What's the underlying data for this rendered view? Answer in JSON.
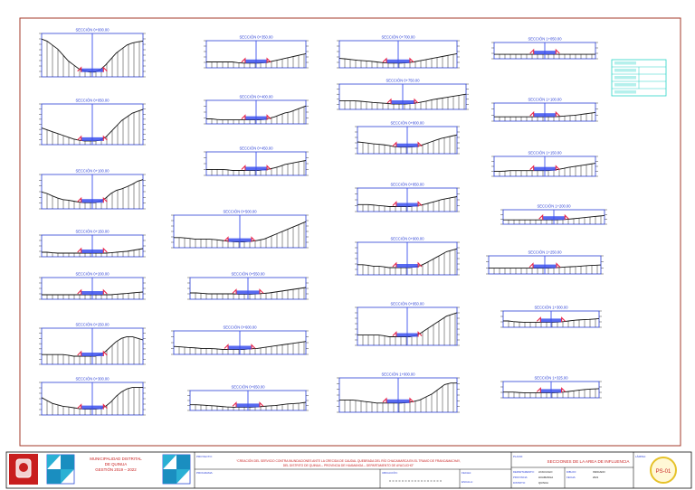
{
  "sheet": {
    "sections": [
      {
        "title": "SECCIÓN 0+000.00",
        "profile": [
          0.95,
          0.9,
          0.8,
          0.7,
          0.55,
          0.4,
          0.3,
          0.2,
          0.15,
          0.12,
          0.12,
          0.18,
          0.3,
          0.45,
          0.6,
          0.7,
          0.8,
          0.85,
          0.88,
          0.9
        ]
      },
      {
        "title": "SECCIÓN 0+050.00",
        "profile": [
          0.45,
          0.4,
          0.35,
          0.3,
          0.25,
          0.2,
          0.15,
          0.12,
          0.1,
          0.1,
          0.1,
          0.12,
          0.2,
          0.35,
          0.5,
          0.65,
          0.75,
          0.85,
          0.9,
          0.95
        ]
      },
      {
        "title": "SECCIÓN 0+100.00",
        "profile": [
          0.55,
          0.5,
          0.42,
          0.35,
          0.3,
          0.28,
          0.25,
          0.22,
          0.2,
          0.2,
          0.2,
          0.25,
          0.35,
          0.5,
          0.6,
          0.65,
          0.72,
          0.8,
          0.9,
          0.95
        ]
      },
      {
        "title": "SECCIÓN 0+150.00",
        "profile": [
          0.25,
          0.25,
          0.22,
          0.2,
          0.2,
          0.2,
          0.2,
          0.2,
          0.2,
          0.2,
          0.2,
          0.2,
          0.2,
          0.22,
          0.25,
          0.28,
          0.3,
          0.35,
          0.4,
          0.45
        ]
      },
      {
        "title": "SECCIÓN 0+200.00",
        "profile": [
          0.25,
          0.25,
          0.25,
          0.25,
          0.25,
          0.25,
          0.25,
          0.25,
          0.25,
          0.25,
          0.25,
          0.25,
          0.25,
          0.25,
          0.28,
          0.3,
          0.32,
          0.35,
          0.38,
          0.4
        ]
      },
      {
        "title": "SECCIÓN 0+250.00",
        "profile": [
          0.3,
          0.3,
          0.3,
          0.3,
          0.3,
          0.28,
          0.25,
          0.25,
          0.25,
          0.25,
          0.25,
          0.3,
          0.4,
          0.55,
          0.7,
          0.8,
          0.85,
          0.85,
          0.8,
          0.75
        ]
      },
      {
        "title": "SECCIÓN 0+300.00",
        "profile": [
          0.6,
          0.5,
          0.4,
          0.35,
          0.3,
          0.28,
          0.25,
          0.22,
          0.2,
          0.2,
          0.2,
          0.22,
          0.3,
          0.45,
          0.65,
          0.8,
          0.9,
          0.95,
          0.95,
          0.95
        ]
      },
      {
        "title": "SECCIÓN 0+350.00",
        "profile": [
          0.25,
          0.25,
          0.25,
          0.25,
          0.25,
          0.25,
          0.22,
          0.2,
          0.2,
          0.2,
          0.2,
          0.22,
          0.25,
          0.3,
          0.35,
          0.4,
          0.45,
          0.5,
          0.55,
          0.6
        ]
      },
      {
        "title": "SECCIÓN 0+400.00",
        "profile": [
          0.25,
          0.25,
          0.22,
          0.2,
          0.2,
          0.2,
          0.2,
          0.2,
          0.2,
          0.2,
          0.2,
          0.22,
          0.28,
          0.35,
          0.45,
          0.55,
          0.6,
          0.7,
          0.8,
          0.9
        ]
      },
      {
        "title": "SECCIÓN 0+450.00",
        "profile": [
          0.3,
          0.3,
          0.3,
          0.3,
          0.28,
          0.25,
          0.25,
          0.25,
          0.25,
          0.25,
          0.25,
          0.28,
          0.32,
          0.38,
          0.45,
          0.55,
          0.6,
          0.65,
          0.7,
          0.75
        ]
      },
      {
        "title": "SECCIÓN 0+500.00",
        "profile": [
          0.35,
          0.35,
          0.33,
          0.3,
          0.3,
          0.3,
          0.28,
          0.25,
          0.22,
          0.2,
          0.2,
          0.22,
          0.25,
          0.3,
          0.4,
          0.5,
          0.6,
          0.7,
          0.8,
          0.9
        ]
      },
      {
        "title": "SECCIÓN 0+550.00",
        "profile": [
          0.35,
          0.35,
          0.33,
          0.3,
          0.3,
          0.3,
          0.3,
          0.3,
          0.28,
          0.28,
          0.28,
          0.3,
          0.32,
          0.35,
          0.4,
          0.45,
          0.5,
          0.55,
          0.6,
          0.65
        ]
      },
      {
        "title": "SECCIÓN 0+600.00",
        "profile": [
          0.4,
          0.38,
          0.35,
          0.33,
          0.3,
          0.3,
          0.28,
          0.25,
          0.25,
          0.25,
          0.25,
          0.28,
          0.3,
          0.35,
          0.4,
          0.45,
          0.5,
          0.55,
          0.6,
          0.65
        ]
      },
      {
        "title": "SECCIÓN 0+650.00",
        "profile": [
          0.35,
          0.35,
          0.33,
          0.3,
          0.28,
          0.25,
          0.22,
          0.2,
          0.2,
          0.2,
          0.2,
          0.22,
          0.25,
          0.28,
          0.3,
          0.35,
          0.4,
          0.42,
          0.45,
          0.5
        ]
      },
      {
        "title": "SECCIÓN 0+700.00",
        "profile": [
          0.4,
          0.38,
          0.35,
          0.32,
          0.3,
          0.28,
          0.25,
          0.22,
          0.2,
          0.2,
          0.2,
          0.22,
          0.25,
          0.3,
          0.35,
          0.4,
          0.45,
          0.5,
          0.55,
          0.6
        ]
      },
      {
        "title": "SECCIÓN 0+750.00",
        "profile": [
          0.4,
          0.4,
          0.4,
          0.38,
          0.35,
          0.32,
          0.3,
          0.28,
          0.25,
          0.25,
          0.25,
          0.28,
          0.32,
          0.38,
          0.45,
          0.5,
          0.55,
          0.6,
          0.65,
          0.7
        ]
      },
      {
        "title": "SECCIÓN 0+800.00",
        "profile": [
          0.5,
          0.48,
          0.45,
          0.42,
          0.4,
          0.38,
          0.35,
          0.3,
          0.28,
          0.28,
          0.28,
          0.3,
          0.35,
          0.42,
          0.5,
          0.58,
          0.65,
          0.7,
          0.75,
          0.8
        ]
      },
      {
        "title": "SECCIÓN 0+850.00",
        "profile": [
          0.35,
          0.35,
          0.35,
          0.33,
          0.3,
          0.28,
          0.25,
          0.25,
          0.25,
          0.25,
          0.25,
          0.28,
          0.32,
          0.38,
          0.45,
          0.52,
          0.6,
          0.65,
          0.7,
          0.75
        ]
      },
      {
        "title": "SECCIÓN 0+900.00",
        "profile": [
          0.35,
          0.35,
          0.33,
          0.3,
          0.3,
          0.28,
          0.25,
          0.25,
          0.25,
          0.25,
          0.25,
          0.28,
          0.32,
          0.4,
          0.5,
          0.6,
          0.7,
          0.8,
          0.85,
          0.9
        ]
      },
      {
        "title": "SECCIÓN 0+950.00",
        "profile": [
          0.3,
          0.3,
          0.3,
          0.3,
          0.3,
          0.28,
          0.25,
          0.25,
          0.25,
          0.25,
          0.25,
          0.28,
          0.35,
          0.45,
          0.55,
          0.65,
          0.75,
          0.85,
          0.9,
          0.95
        ]
      },
      {
        "title": "SECCIÓN 1+000.00",
        "profile": [
          0.4,
          0.4,
          0.4,
          0.38,
          0.35,
          0.33,
          0.3,
          0.3,
          0.3,
          0.3,
          0.3,
          0.32,
          0.35,
          0.4,
          0.5,
          0.6,
          0.75,
          0.9,
          0.95,
          0.95
        ]
      },
      {
        "title": "SECCIÓN 1+050.00",
        "profile": [
          0.35,
          0.35,
          0.35,
          0.35,
          0.35,
          0.35,
          0.35,
          0.35,
          0.35,
          0.35,
          0.35,
          0.35,
          0.35,
          0.35,
          0.35,
          0.35,
          0.35,
          0.35,
          0.35,
          0.35
        ]
      },
      {
        "title": "SECCIÓN 1+100.00",
        "profile": [
          0.3,
          0.3,
          0.3,
          0.3,
          0.3,
          0.3,
          0.3,
          0.3,
          0.3,
          0.3,
          0.3,
          0.3,
          0.32,
          0.35,
          0.38,
          0.4,
          0.45,
          0.5,
          0.55,
          0.6
        ]
      },
      {
        "title": "SECCIÓN 1+150.00",
        "profile": [
          0.3,
          0.3,
          0.32,
          0.35,
          0.35,
          0.35,
          0.35,
          0.35,
          0.35,
          0.35,
          0.35,
          0.38,
          0.42,
          0.48,
          0.55,
          0.6,
          0.65,
          0.7,
          0.75,
          0.8
        ]
      },
      {
        "title": "SECCIÓN 1+200.00",
        "profile": [
          0.4,
          0.4,
          0.4,
          0.4,
          0.4,
          0.4,
          0.4,
          0.4,
          0.4,
          0.4,
          0.4,
          0.42,
          0.45,
          0.5,
          0.55,
          0.6,
          0.65,
          0.7,
          0.75,
          0.8
        ]
      },
      {
        "title": "SECCIÓN 1+250.00",
        "profile": [
          0.4,
          0.4,
          0.4,
          0.4,
          0.4,
          0.4,
          0.4,
          0.4,
          0.4,
          0.4,
          0.4,
          0.42,
          0.45,
          0.48,
          0.5,
          0.52,
          0.55,
          0.58,
          0.6,
          0.62
        ]
      },
      {
        "title": "SECCIÓN 1+300.00",
        "profile": [
          0.5,
          0.5,
          0.45,
          0.42,
          0.4,
          0.4,
          0.4,
          0.4,
          0.4,
          0.4,
          0.4,
          0.42,
          0.45,
          0.5,
          0.55,
          0.58,
          0.6,
          0.62,
          0.65,
          0.68
        ]
      },
      {
        "title": "SECCIÓN 1+325.00",
        "profile": [
          0.45,
          0.45,
          0.45,
          0.42,
          0.4,
          0.4,
          0.4,
          0.4,
          0.4,
          0.4,
          0.4,
          0.42,
          0.45,
          0.5,
          0.55,
          0.6,
          0.65,
          0.68,
          0.7,
          0.72
        ]
      }
    ]
  },
  "title_block": {
    "municipality_line1": "MUNICIPALIDAD DISTRITAL",
    "municipality_line2": "DE QUINUA",
    "period": "GESTIÓN 2019 – 2022",
    "project_label": "PROYECTO:",
    "project_line1": "“CREACIÓN DEL SERVICIO CONTRA INUNDACIONES ANTE LA CRECIDA DE CAUDAL QUEBRADA DEL RÍO CHACAMARCA EN EL TRAMO DE FRANCAMACHAY,",
    "project_line2": "DEL DISTRITO DE QUINUA – PROVINCIA DE HUAMANGA – DEPARTAMENTO DE AYACUCHO”",
    "program_label": "PROGRAMA:",
    "field_labels": [
      "DIBUJO:",
      "REVISADO:"
    ],
    "location_label": "UBICACIÓN:",
    "date_label": "FECHA:",
    "scale_label": "ESCALA:",
    "plane_label": "PLANO:",
    "plane_title": "SECCIONES DE LA AREA DE INFLUENCIA",
    "meta": [
      {
        "label": "DEPARTAMENTO:",
        "value": "AYACUCHO"
      },
      {
        "label": "PROVINCIA:",
        "value": "HUAMANGA"
      },
      {
        "label": "DISTRITO:",
        "value": "QUINUA"
      }
    ],
    "meta_right": [
      {
        "label": "DIBUJO:",
        "value": "INDICADO"
      },
      {
        "label": "FECHA:",
        "value": "2021"
      }
    ],
    "sheet_label": "LÁMINA:",
    "sheet_code": "PS-01"
  },
  "legend_rows": 5,
  "colors": {
    "border": "#a33a2a",
    "frame": "#2a3fd6",
    "grid": "#111111",
    "channel": "#3b50ee",
    "wall": "#e8264a",
    "legend": "#2ad4c8",
    "titles": "#2a3fd6",
    "logo": "#c81e1e",
    "stamp": "#e6c229"
  }
}
